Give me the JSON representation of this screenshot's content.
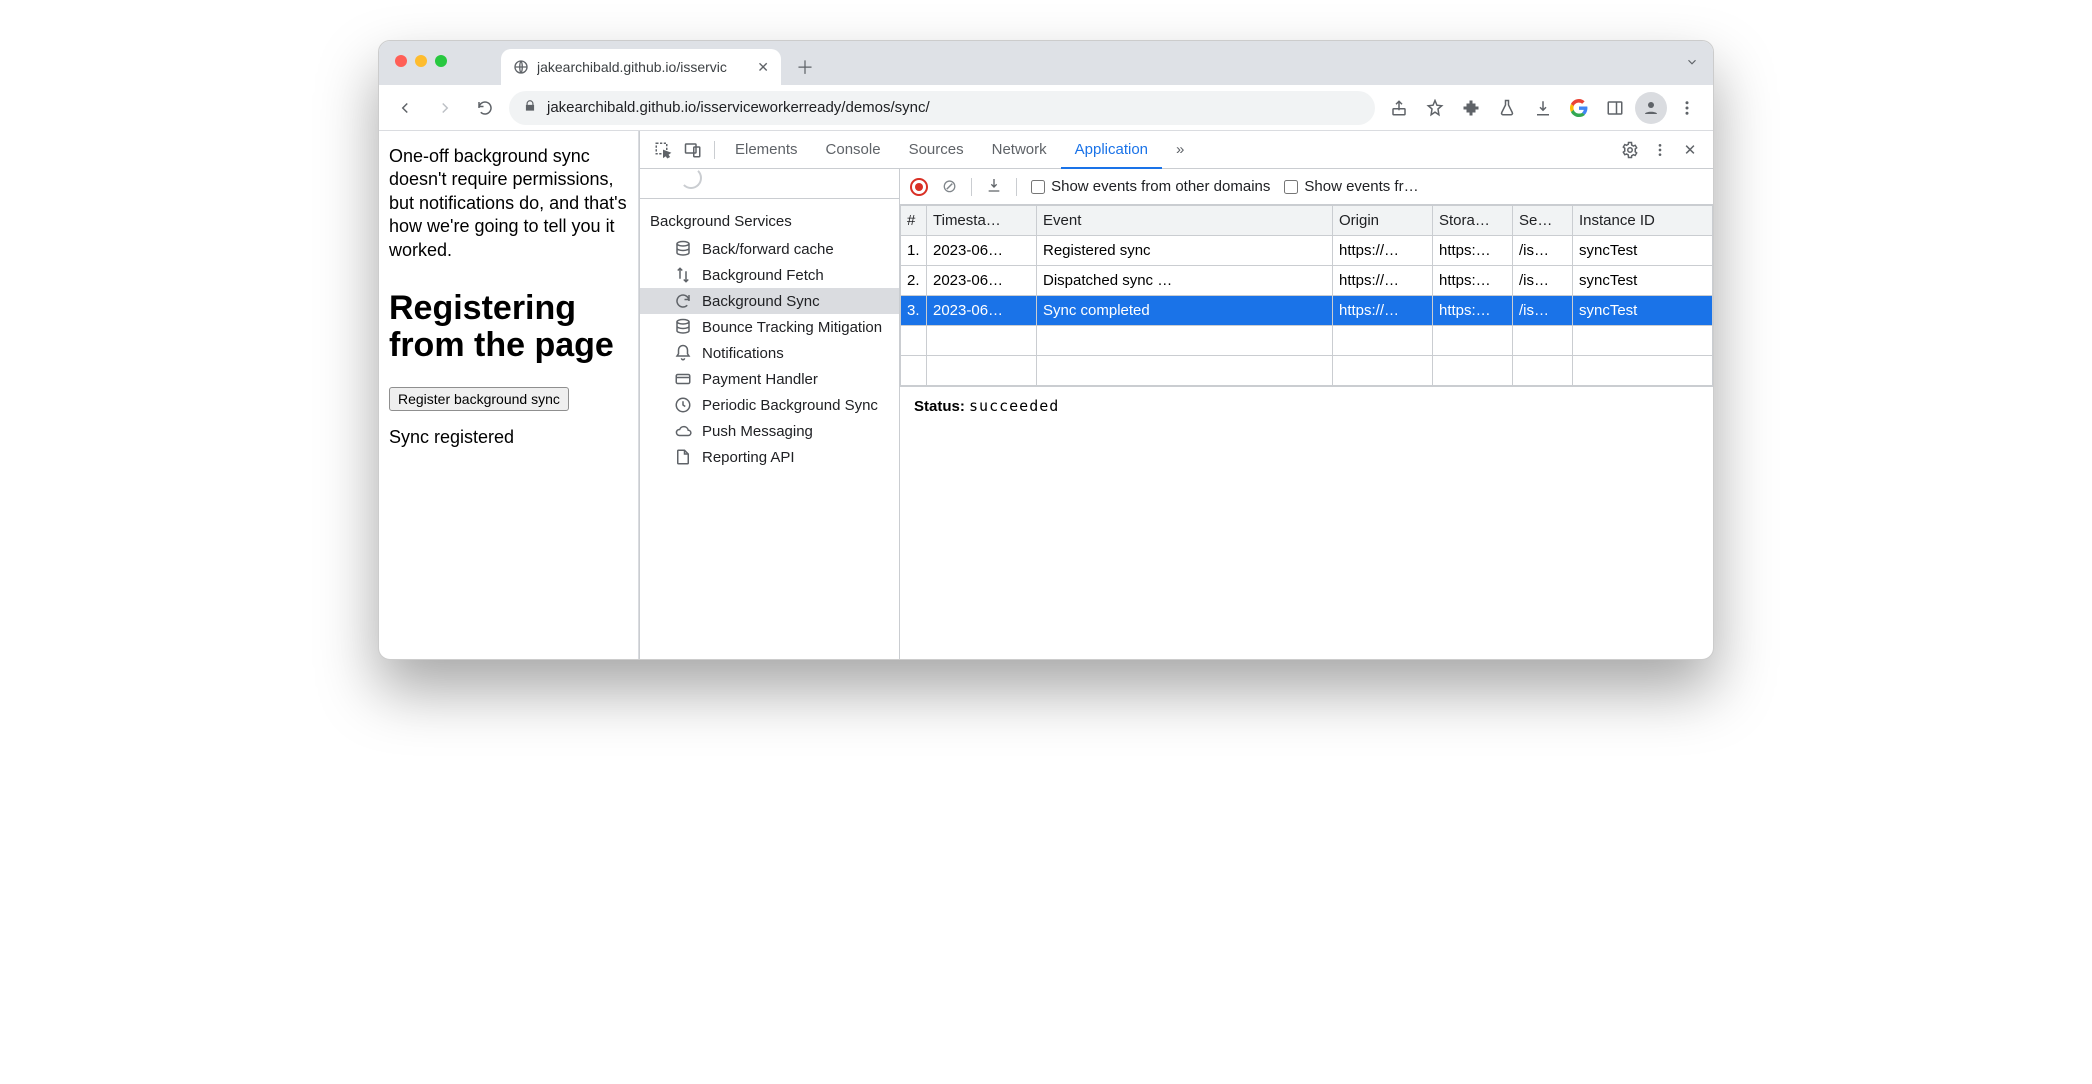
{
  "browser_tab": {
    "title": "jakearchibald.github.io/isservic",
    "url_display": "jakearchibald.github.io/isserviceworkerready/demos/sync/"
  },
  "page": {
    "intro": "One-off background sync doesn't require permissions, but notifications do, and that's how we're going to tell you it worked.",
    "heading": "Registering from the page",
    "button_label": "Register background sync",
    "status": "Sync registered"
  },
  "devtools": {
    "tabs": [
      "Elements",
      "Console",
      "Sources",
      "Network",
      "Application"
    ],
    "active_tab": "Application",
    "more_tabs_glyph": "»",
    "sidebar": {
      "group_title": "Background Services",
      "items": [
        {
          "label": "Back/forward cache",
          "icon": "database"
        },
        {
          "label": "Background Fetch",
          "icon": "updown"
        },
        {
          "label": "Background Sync",
          "icon": "sync",
          "selected": true
        },
        {
          "label": "Bounce Tracking Mitigation",
          "icon": "database"
        },
        {
          "label": "Notifications",
          "icon": "bell"
        },
        {
          "label": "Payment Handler",
          "icon": "card"
        },
        {
          "label": "Periodic Background Sync",
          "icon": "clock"
        },
        {
          "label": "Push Messaging",
          "icon": "cloud"
        },
        {
          "label": "Reporting API",
          "icon": "file"
        }
      ]
    },
    "actionbar": {
      "show_other_label": "Show events from other domains",
      "show_events_fr_label": "Show events fr…"
    },
    "table": {
      "columns": [
        "#",
        "Timesta…",
        "Event",
        "Origin",
        "Stora…",
        "Se…",
        "Instance ID"
      ],
      "rows": [
        {
          "n": "1.",
          "ts": "2023-06…",
          "event": "Registered sync",
          "origin": "https://…",
          "storage": "https:…",
          "scope": "/is…",
          "instance": "syncTest"
        },
        {
          "n": "2.",
          "ts": "2023-06…",
          "event": "Dispatched sync …",
          "origin": "https://…",
          "storage": "https:…",
          "scope": "/is…",
          "instance": "syncTest"
        },
        {
          "n": "3.",
          "ts": "2023-06…",
          "event": "Sync completed",
          "origin": "https://…",
          "storage": "https:…",
          "scope": "/is…",
          "instance": "syncTest",
          "selected": true
        }
      ]
    },
    "status": {
      "label": "Status:",
      "value": "succeeded"
    }
  }
}
